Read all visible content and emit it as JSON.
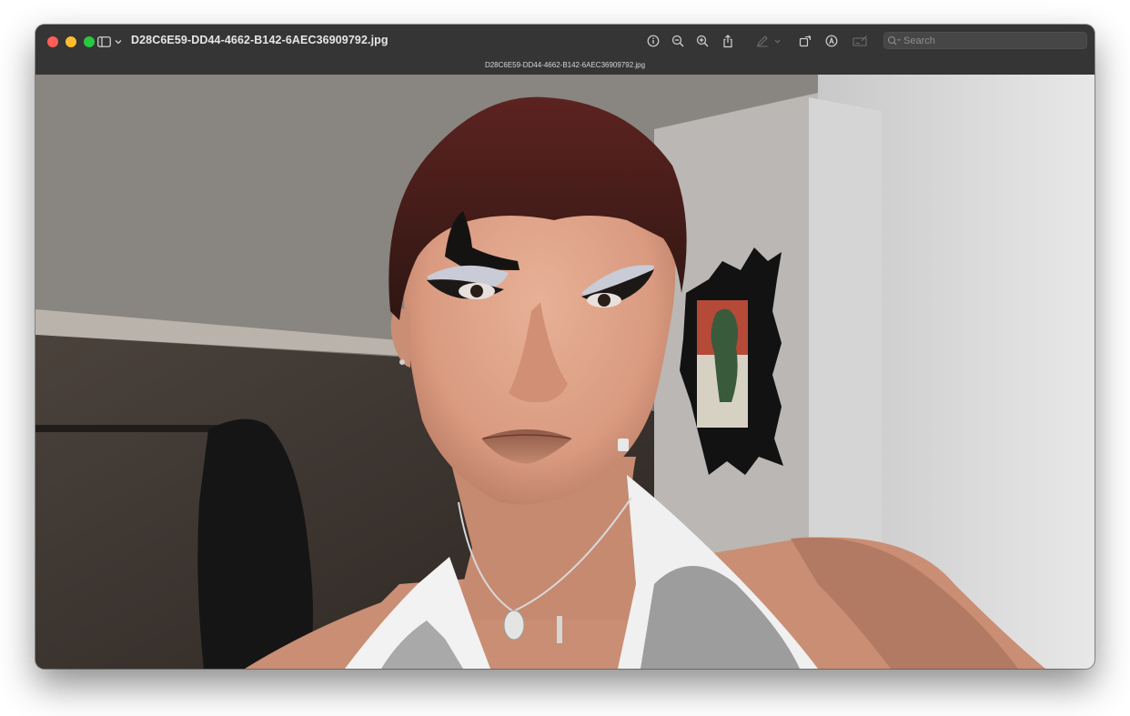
{
  "window": {
    "title": "D28C6E59-DD44-4662-B142-6AEC36909792.jpg",
    "filename_label": "D28C6E59-DD44-4662-B142-6AEC36909792.jpg"
  },
  "toolbar": {
    "icons": [
      "sidebar-icon",
      "chevron-down-icon",
      "info-icon",
      "zoom-out-icon",
      "zoom-in-icon",
      "share-icon",
      "markup-pen-icon",
      "chevron-down-icon",
      "rotate-icon",
      "annotate-icon",
      "form-fill-icon"
    ]
  },
  "search": {
    "placeholder": "Search",
    "value": ""
  },
  "colors": {
    "titlebar": "#353535",
    "close": "#ff5f57",
    "minimize": "#febc2e",
    "maximize": "#28c840"
  }
}
